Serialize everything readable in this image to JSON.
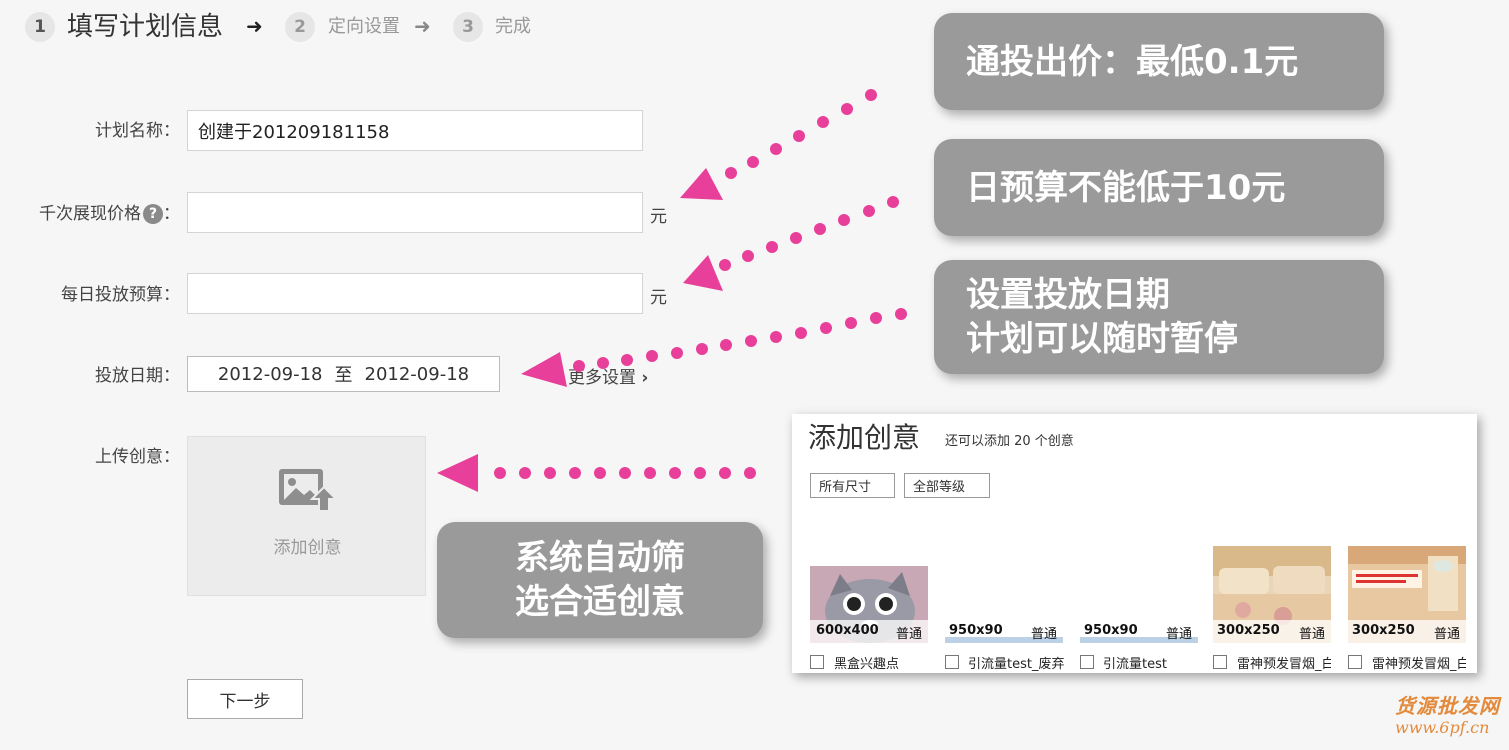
{
  "stepper": {
    "steps": [
      {
        "number": "1",
        "label": "填写计划信息",
        "arrow": "➜"
      },
      {
        "number": "2",
        "label": "定向设置",
        "arrow": "➜"
      },
      {
        "number": "3",
        "label": "完成"
      }
    ]
  },
  "form": {
    "plan_name": {
      "label": "计划名称：",
      "value": "创建于201209181158"
    },
    "cpm_price": {
      "label": "千次展现价格",
      "help": "?",
      "colon": "：",
      "value": "",
      "unit": "元"
    },
    "daily_budget": {
      "label": "每日投放预算：",
      "value": "",
      "unit": "元"
    },
    "date_range": {
      "label": "投放日期：",
      "start": "2012-09-18",
      "separator": "至",
      "end": "2012-09-18",
      "more": "更多设置",
      "more_icon": "›"
    },
    "upload": {
      "label": "上传创意：",
      "button_text": "添加创意"
    },
    "next_button": "下一步"
  },
  "callouts": {
    "bid": "通投出价：最低0.1元",
    "budget": "日预算不能低于10元",
    "date_line1": "设置投放日期",
    "date_line2": "计划可以随时暂停",
    "auto_line1": "系统自动筛",
    "auto_line2": "选合适创意"
  },
  "creative_panel": {
    "title": "添加创意",
    "subtitle": "还可以添加 20 个创意",
    "filters": [
      "所有尺寸",
      "全部等级"
    ],
    "creatives": [
      {
        "size": "600x400",
        "level": "普通",
        "name": "黑盒兴趣点"
      },
      {
        "size": "950x90",
        "level": "普通",
        "name": "引流量test_废弃"
      },
      {
        "size": "950x90",
        "level": "普通",
        "name": "引流量test"
      },
      {
        "size": "300x250",
        "level": "普通",
        "name": "雷神预发冒烟_白"
      },
      {
        "size": "300x250",
        "level": "普通",
        "name": "雷神预发冒烟_白"
      }
    ]
  },
  "watermark": {
    "text": "货源批发网",
    "url": "www.6pf.cn"
  },
  "colors": {
    "arrow": "#e8409a",
    "callout_bg": "#9a9a9a",
    "watermark": "#e38a3c"
  }
}
